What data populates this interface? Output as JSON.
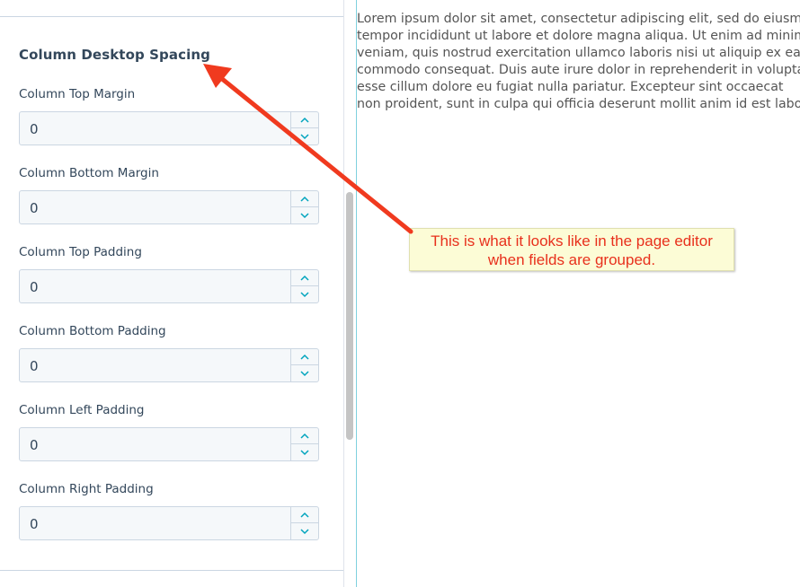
{
  "panel": {
    "group_title": "Column Desktop Spacing",
    "fields": [
      {
        "label": "Column Top Margin",
        "value": "0"
      },
      {
        "label": "Column Bottom Margin",
        "value": "0"
      },
      {
        "label": "Column Top Padding",
        "value": "0"
      },
      {
        "label": "Column Bottom Padding",
        "value": "0"
      },
      {
        "label": "Column Left Padding",
        "value": "0"
      },
      {
        "label": "Column Right Padding",
        "value": "0"
      }
    ]
  },
  "preview": {
    "lines": [
      "Lorem ipsum dolor sit amet, consectetur adipiscing elit, sed do eiusmod",
      "tempor incididunt ut labore et dolore magna aliqua. Ut enim ad minim",
      "veniam, quis nostrud exercitation ullamco laboris nisi ut aliquip ex ea",
      "commodo consequat. Duis aute irure dolor in reprehenderit in voluptate",
      "esse cillum dolore eu fugiat nulla pariatur. Excepteur sint occaecat",
      "non proident, sunt in culpa qui officia deserunt mollit anim id est laborum."
    ]
  },
  "annotation": {
    "line1": "This is what it looks like in the page editor",
    "line2": "when fields are grouped."
  },
  "icons": {
    "stepper_up": "chevron-up-icon",
    "stepper_down": "chevron-down-icon",
    "annotation_arrow": "arrow-icon"
  },
  "colors": {
    "text": "#33475b",
    "field_bg": "#f5f8fa",
    "field_border": "#cbd6e2",
    "stepper_icon": "#00a4bd",
    "annotation_text": "#e8301c",
    "annotation_bg": "#fcfcd6",
    "arrow": "#f03a1f"
  }
}
